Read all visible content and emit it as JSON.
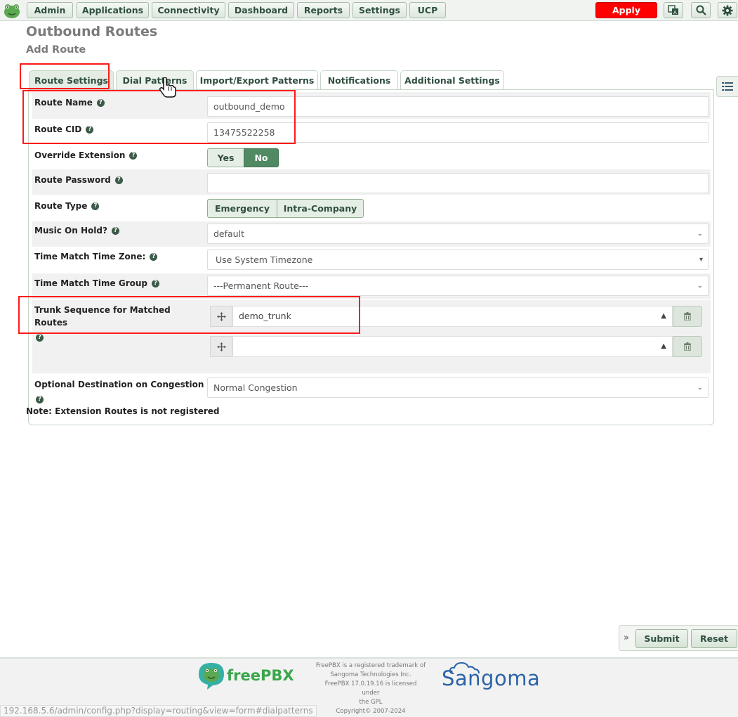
{
  "nav": {
    "items": [
      "Admin",
      "Applications",
      "Connectivity",
      "Dashboard",
      "Reports",
      "Settings",
      "UCP"
    ],
    "apply_config": "Apply Config"
  },
  "page": {
    "title": "Outbound Routes",
    "subtitle": "Add Route"
  },
  "tabs": [
    "Route Settings",
    "Dial Patterns",
    "Import/Export Patterns",
    "Notifications",
    "Additional Settings"
  ],
  "form": {
    "route_name": {
      "label": "Route Name",
      "value": "outbound_demo"
    },
    "route_cid": {
      "label": "Route CID",
      "value": "13475522258"
    },
    "override_extension": {
      "label": "Override Extension",
      "yes": "Yes",
      "no": "No",
      "selected": "No"
    },
    "route_password": {
      "label": "Route Password",
      "value": ""
    },
    "route_type": {
      "label": "Route Type",
      "emergency": "Emergency",
      "intra_company": "Intra-Company"
    },
    "music_on_hold": {
      "label": "Music On Hold?",
      "value": "default"
    },
    "time_zone": {
      "label": "Time Match Time Zone:",
      "value": "Use System Timezone"
    },
    "time_group": {
      "label": "Time Match Time Group",
      "value": "---Permanent Route---"
    },
    "trunk_sequence": {
      "label_line1": "Trunk Sequence for Matched",
      "label_line2": "Routes",
      "trunks": [
        "demo_trunk",
        ""
      ]
    },
    "congestion": {
      "label": "Optional Destination on Congestion",
      "value": "Normal Congestion"
    }
  },
  "note": "Note: Extension Routes is not registered",
  "actions": {
    "submit": "Submit",
    "reset": "Reset"
  },
  "footer": {
    "freepbx": "freePBX",
    "legal_lines": [
      "FreePBX is a registered trademark of",
      "Sangoma Technologies Inc.",
      "FreePBX 17.0.19.16 is licensed under",
      "the GPL",
      "Copyright© 2007-2024"
    ],
    "sangoma": "Sangoma"
  },
  "status_url": "192.168.5.6/admin/config.php?display=routing&view=form#dialpatterns",
  "colors": {
    "apply": "#ff0000",
    "toggle_active": "#4f8a62",
    "highlight_box": "#ff1a1a"
  }
}
